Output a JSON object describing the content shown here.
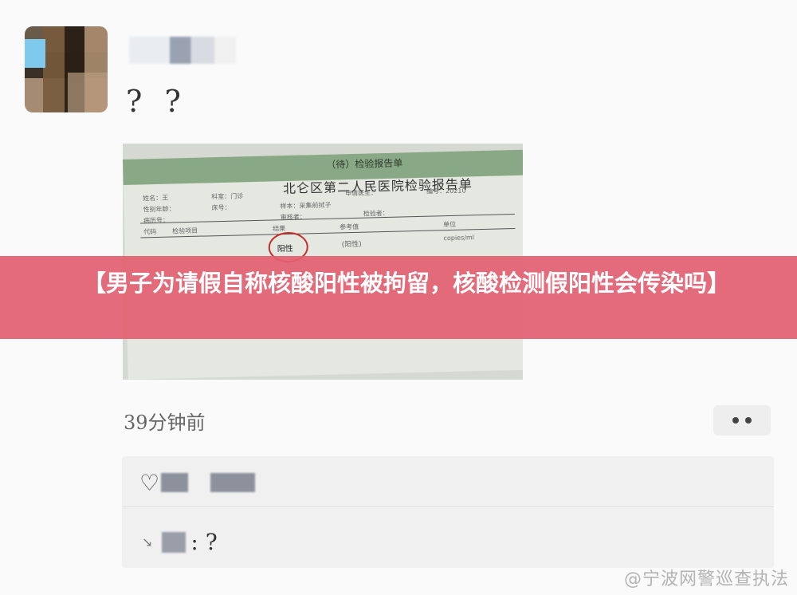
{
  "post": {
    "text": "? ?",
    "timestamp": "39分钟前"
  },
  "report_image": {
    "title": "北仑区第二人民医院检验报告单",
    "header_partial": "（待）检验报告单",
    "result_word": "阳性",
    "result_value": "(阳性)",
    "fine_text": [
      "姓名：王",
      "性别年龄：",
      "病历号：",
      "代码",
      "检验项目",
      "科室：门诊",
      "床号：",
      "结果",
      "参考值",
      "单位",
      "copies/ml",
      "编号：20210",
      "检验者：",
      "样本：采集前拭子",
      "申请医生：",
      "审核者："
    ]
  },
  "banner": {
    "text": "【男子为请假自称核酸阳性被拘留，核酸检测假阳性会传染吗】"
  },
  "comments": {
    "like_icon": "heart-icon",
    "comment_text": ": ?"
  },
  "watermark": {
    "text": "@宁波网警巡查执法"
  },
  "colors": {
    "banner": "#e26071",
    "background": "#fafafa",
    "comment_box": "#f0f0f0",
    "stamp_red": "#c62c2a"
  }
}
